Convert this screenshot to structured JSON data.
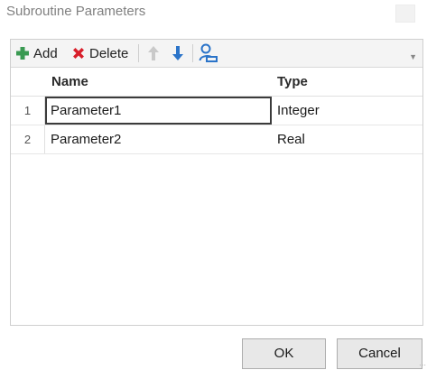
{
  "window": {
    "title": "Subroutine Parameters"
  },
  "toolbar": {
    "add_label": "Add",
    "delete_label": "Delete",
    "icons": {
      "add": "plus-icon",
      "delete": "x-icon",
      "move_up": "arrow-up-icon",
      "move_down": "arrow-down-icon",
      "rename": "person-edit-icon",
      "overflow": "chevron-down-icon"
    },
    "colors": {
      "add": "#3a9a52",
      "delete": "#d81e2a",
      "move_up_disabled": "#c9c9c9",
      "move_down": "#2b74c9",
      "rename": "#2b74c9"
    }
  },
  "grid": {
    "columns": [
      "Name",
      "Type"
    ],
    "rows": [
      {
        "num": "1",
        "name": "Parameter1",
        "type": "Integer",
        "selected": true
      },
      {
        "num": "2",
        "name": "Parameter2",
        "type": "Real",
        "selected": false
      }
    ]
  },
  "footer": {
    "ok_label": "OK",
    "cancel_label": "Cancel"
  }
}
